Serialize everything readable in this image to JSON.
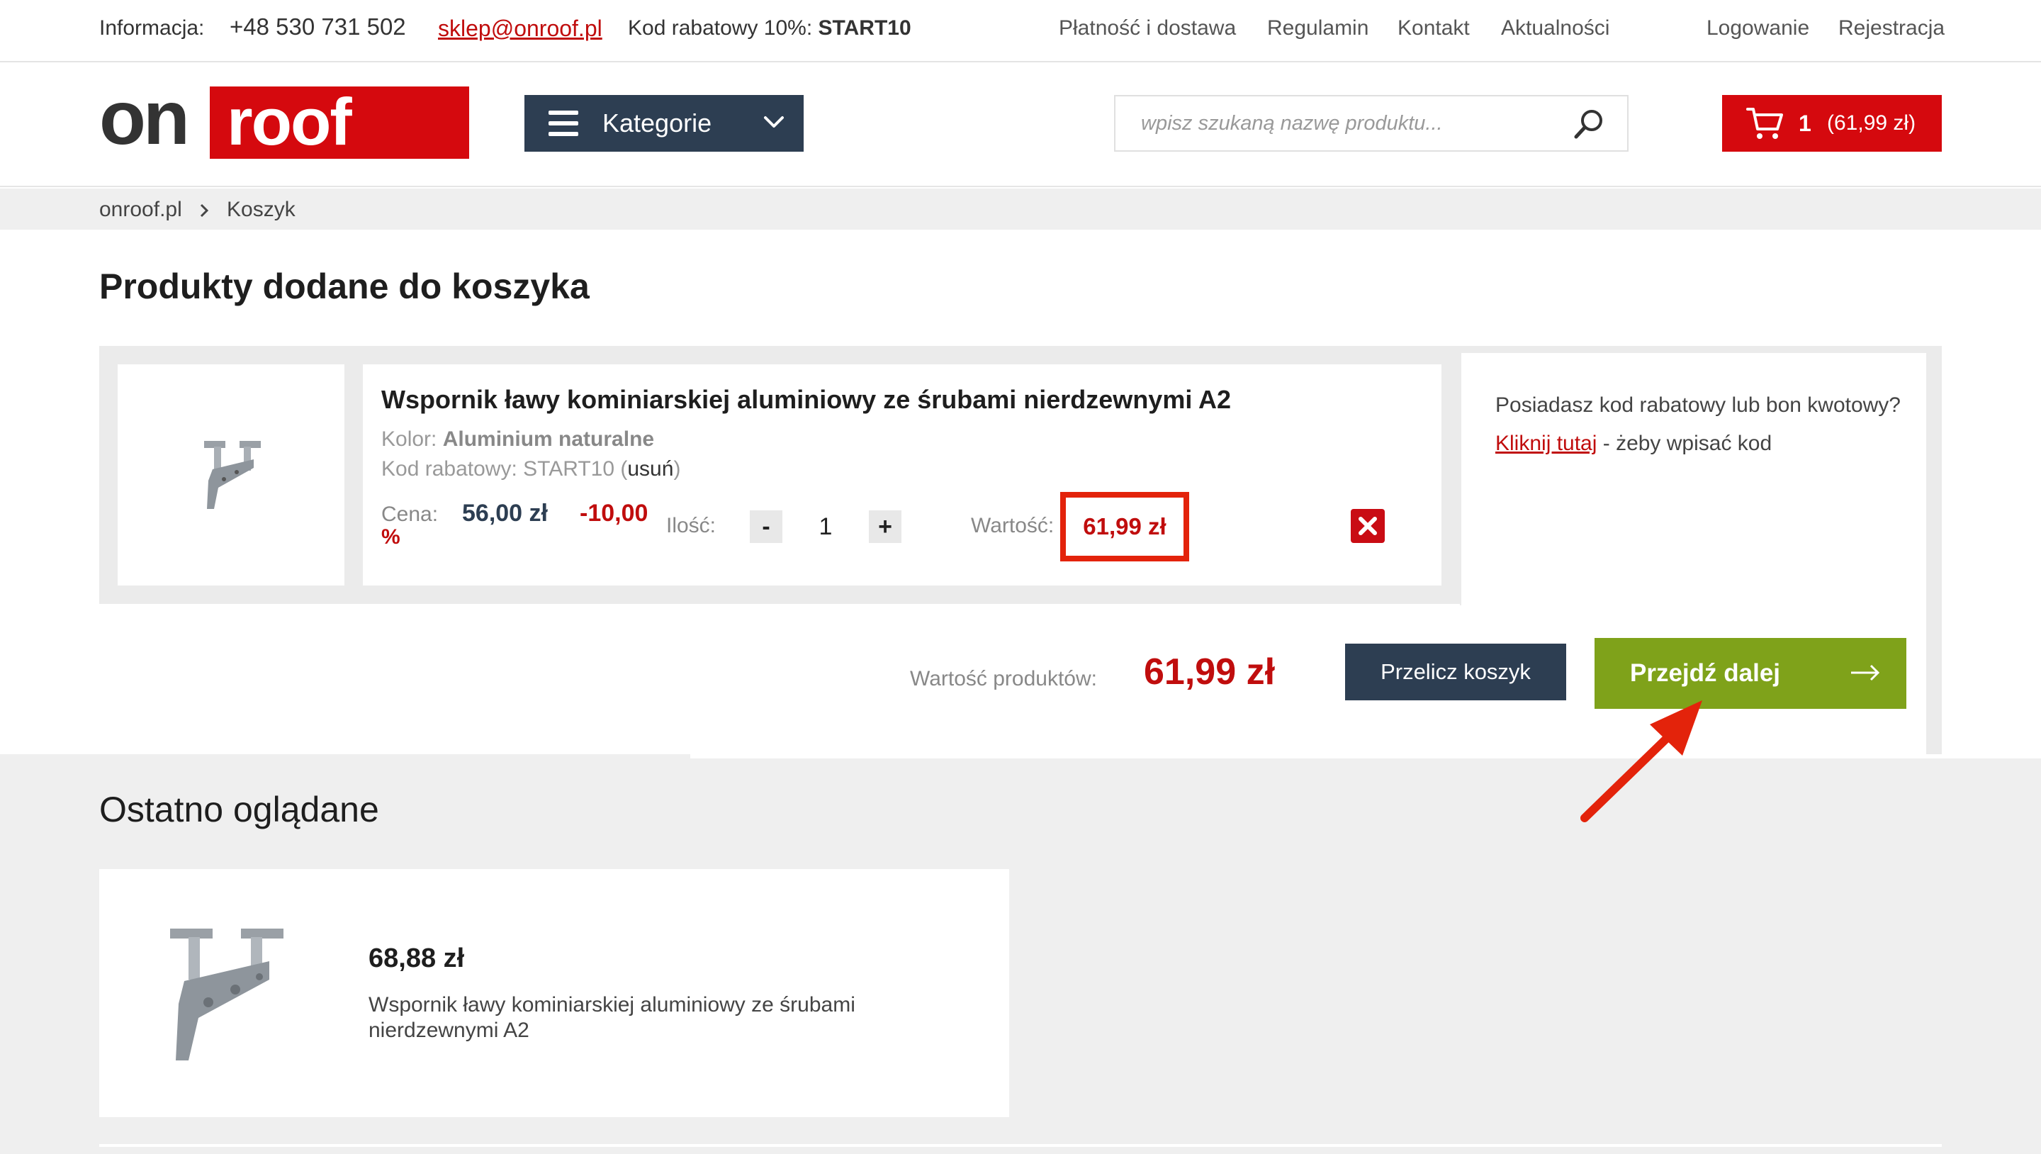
{
  "topbar": {
    "info_label": "Informacja:",
    "phone": "+48 530 731 502",
    "email": "sklep@onroof.pl",
    "discount_text": "Kod rabatowy 10%:",
    "discount_code": "START10",
    "nav": [
      "Płatność i dostawa",
      "Regulamin",
      "Kontakt",
      "Aktualności"
    ],
    "login": "Logowanie",
    "register": "Rejestracja"
  },
  "header": {
    "logo_on": "on",
    "logo_roof": "roof",
    "categories_label": "Kategorie",
    "search_placeholder": "wpisz szukaną nazwę produktu...",
    "cart_count": "1",
    "cart_total": "(61,99 zł)",
    "brand_color": "#d5090e",
    "nav_color": "#2d3e52"
  },
  "breadcrumb": {
    "home": "onroof.pl",
    "current": "Koszyk"
  },
  "cart": {
    "title": "Produkty dodane do koszyka",
    "item": {
      "name": "Wspornik ławy kominiarskiej aluminiowy ze śrubami nierdzewnymi A2",
      "color_label": "Kolor:",
      "color_value": "Aluminium naturalne",
      "code_label": "Kod rabatowy: START10 (",
      "code_remove": "usuń",
      "code_close": ")",
      "price_label": "Cena:",
      "price_value": "56,00 zł",
      "discount_value": "-10,00",
      "discount_pct": "%",
      "qty_label": "Ilość:",
      "qty_minus": "-",
      "qty_value": "1",
      "qty_plus": "+",
      "value_label": "Wartość:",
      "value": "61,99 zł"
    },
    "promo_question": "Posiadasz kod rabatowy lub bon kwotowy?",
    "promo_link": "Kliknij tutaj",
    "promo_rest": " - żeby wpisać kod",
    "summary_label": "Wartość produktów:",
    "summary_value": "61,99 zł",
    "recalc_button": "Przelicz koszyk",
    "next_button": "Przejdź dalej",
    "next_color": "#7fa21a"
  },
  "recent": {
    "title": "Ostatno oglądane",
    "items": [
      {
        "price": "68,88 zł",
        "name": "Wspornik ławy kominiarskiej aluminiowy ze śrubami nierdzewnymi A2"
      }
    ]
  }
}
